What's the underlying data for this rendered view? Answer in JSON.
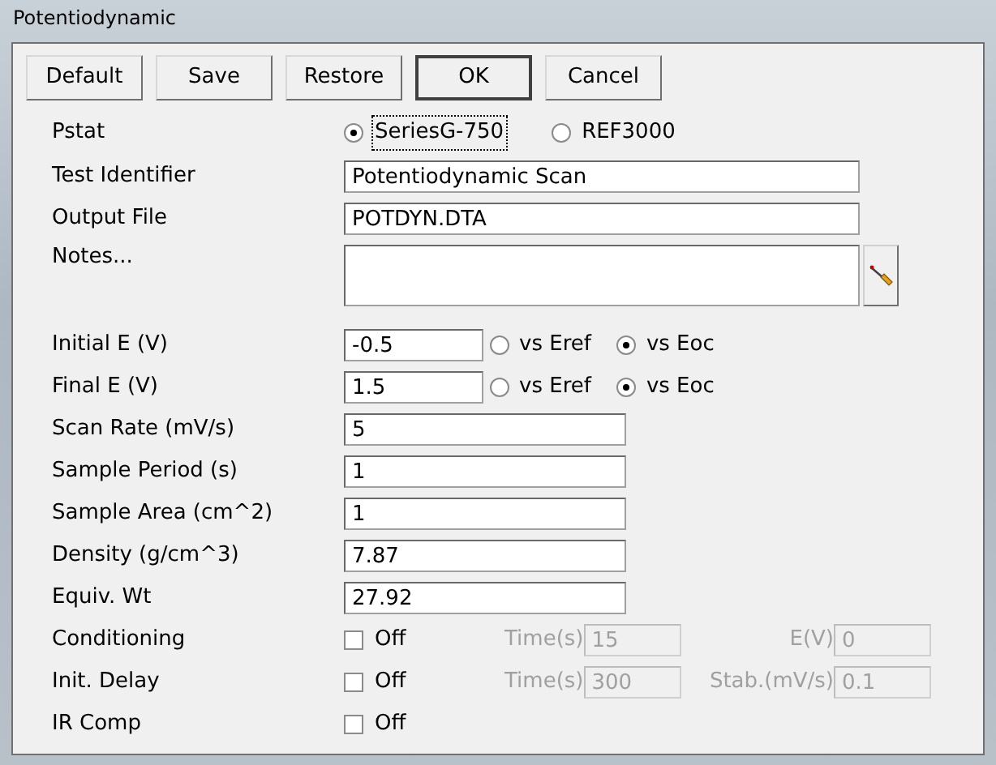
{
  "window": {
    "title": "Potentiodynamic"
  },
  "buttons": [
    {
      "label": "Default",
      "default": false
    },
    {
      "label": "Save",
      "default": false
    },
    {
      "label": "Restore",
      "default": false
    },
    {
      "label": "OK",
      "default": true
    },
    {
      "label": "Cancel",
      "default": false
    }
  ],
  "rows": [
    {
      "kind": "radio",
      "label": "Pstat",
      "options": [
        {
          "label": "SeriesG-750",
          "selected": true,
          "focused": true
        },
        {
          "label": "REF3000",
          "selected": false,
          "focused": false
        }
      ]
    },
    {
      "kind": "wide_text",
      "label": "Test Identifier",
      "value": "Potentiodynamic Scan"
    },
    {
      "kind": "wide_text",
      "label": "Output File",
      "value": "POTDYN.DTA"
    },
    {
      "kind": "notes",
      "label": "Notes..."
    },
    {
      "kind": "potential",
      "label": "Initial E (V)",
      "value": "-0.5",
      "options": [
        {
          "label": "vs Eref",
          "selected": false
        },
        {
          "label": "vs Eoc",
          "selected": true
        }
      ]
    },
    {
      "kind": "potential",
      "label": "Final E (V)",
      "value": "1.5",
      "options": [
        {
          "label": "vs Eref",
          "selected": false
        },
        {
          "label": "vs Eoc",
          "selected": true
        }
      ]
    },
    {
      "kind": "text",
      "label": "Scan Rate (mV/s)",
      "value": "5"
    },
    {
      "kind": "text",
      "label": "Sample Period (s)",
      "value": "1"
    },
    {
      "kind": "text",
      "label": "Sample Area (cm^2)",
      "value": "1"
    },
    {
      "kind": "text",
      "label": "Density (g/cm^3)",
      "value": "7.87"
    },
    {
      "kind": "text",
      "label": "Equiv. Wt",
      "value": "27.92"
    },
    {
      "kind": "checkbox",
      "label": "Conditioning",
      "check_label": "Off",
      "checked": false,
      "params": [
        {
          "label": "Time(s)",
          "value": "15",
          "disabled": true
        },
        {
          "label": "E(V)",
          "value": "0",
          "disabled": true
        }
      ]
    },
    {
      "kind": "checkbox",
      "label": "Init. Delay",
      "check_label": "Off",
      "checked": false,
      "params": [
        {
          "label": "Time(s)",
          "value": "300",
          "disabled": true
        },
        {
          "label": "Stab.(mV/s)",
          "value": "0.1",
          "disabled": true
        }
      ]
    },
    {
      "kind": "checkbox",
      "label": "IR Comp",
      "check_label": "Off",
      "checked": false
    }
  ]
}
